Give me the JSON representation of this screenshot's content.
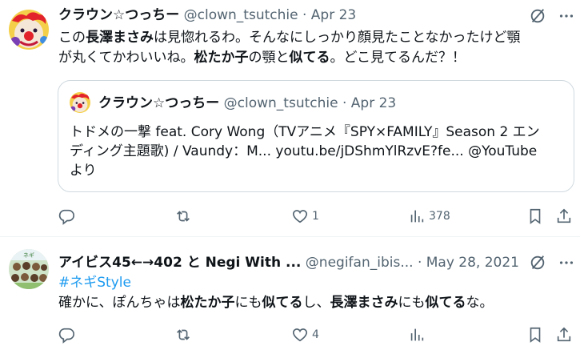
{
  "tweets": [
    {
      "author_name": "クラウン☆つっちー",
      "handle": "@clown_tsutchie",
      "dot": "·",
      "date": "Apr 23",
      "text_segments": [
        "この",
        "長澤まさみ",
        "は見惚れるわ。そんなにしっかり顔見たことなかったけど顎",
        "が丸くてかわいいね。",
        "松たか子",
        "の顎と",
        "似てる",
        "。どこ見てるんだ？！"
      ],
      "quote": {
        "author_name": "クラウン☆つっちー",
        "handle": "@clown_tsutchie",
        "dot": "·",
        "date": "Apr 23",
        "line1": "トドメの一撃 feat. Cory Wong（TVアニメ『SPY×FAMILY』Season 2 エン",
        "line2": "ディング主題歌) / Vaundy：M... youtu.be/jDShmYlRzvE?fe... @YouTube",
        "line3": "より"
      },
      "actions": {
        "reply": "",
        "retweet": "",
        "like": "1",
        "views": "378"
      }
    },
    {
      "author_name": "アイビス45←→402 と Negi With ...",
      "handle": "@negifan_ibis...",
      "dot": "·",
      "date": "May 28, 2021",
      "hashtag": "#ネギStyle",
      "text_segments": [
        "確かに、ぽんちゃは",
        "松たか子",
        "にも",
        "似てる",
        "し、",
        "長澤まさみ",
        "にも",
        "似てる",
        "な。"
      ],
      "actions": {
        "reply": "",
        "retweet": "",
        "like": "4",
        "views": ""
      }
    }
  ],
  "icons": [
    "grok-icon",
    "more-icon",
    "reply-icon",
    "retweet-icon",
    "like-icon",
    "views-icon",
    "bookmark-icon",
    "share-icon"
  ],
  "colors": {
    "text": "#0f1419",
    "secondary": "#536471",
    "link": "#1d9bf0",
    "border": "#cfd9de"
  }
}
